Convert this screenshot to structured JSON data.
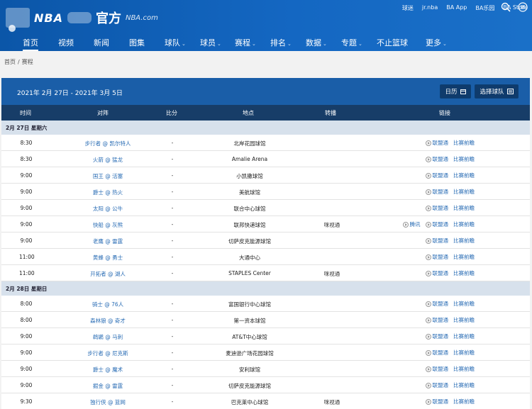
{
  "header": {
    "logo_nba": "NBA",
    "logo_cn": "官方",
    "logo_domain": "NBA.com",
    "top_links": [
      "球迷",
      "jr.nba",
      "BA App",
      "BA乐园",
      "BA Store"
    ]
  },
  "nav": {
    "items": [
      {
        "label": "首页",
        "caret": false,
        "active": true
      },
      {
        "label": "视频",
        "caret": false
      },
      {
        "label": "新闻",
        "caret": false
      },
      {
        "label": "图集",
        "caret": false
      },
      {
        "label": "球队",
        "caret": true
      },
      {
        "label": "球员",
        "caret": true
      },
      {
        "label": "赛程",
        "caret": true
      },
      {
        "label": "排名",
        "caret": true
      },
      {
        "label": "数据",
        "caret": true
      },
      {
        "label": "专题",
        "caret": true
      },
      {
        "label": "不止篮球",
        "caret": false
      },
      {
        "label": "更多",
        "caret": true
      }
    ]
  },
  "breadcrumb": [
    "首页",
    "赛程"
  ],
  "schedule": {
    "date_range": "2021年 2月 27日 - 2021年 3月 5日",
    "calendar_button": "日历",
    "team_button": "选择球队",
    "columns": [
      "时间",
      "对阵",
      "比分",
      "地点",
      "转播",
      "链接"
    ],
    "days": [
      {
        "date": "2月 27日 星期六",
        "games": [
          {
            "time": "8:30",
            "match": "步行者 @ 凯尔特人",
            "score": "-",
            "venue": "北岸花园球馆",
            "broadcast": "",
            "links": [
              "联盟通",
              "比赛前瞻"
            ]
          },
          {
            "time": "8:30",
            "match": "火箭 @ 猛龙",
            "score": "-",
            "venue": "Amalie Arena",
            "broadcast": "",
            "links": [
              "联盟通",
              "比赛前瞻"
            ]
          },
          {
            "time": "9:00",
            "match": "国王 @ 活塞",
            "score": "-",
            "venue": "小凯撒球馆",
            "broadcast": "",
            "links": [
              "联盟通",
              "比赛前瞻"
            ]
          },
          {
            "time": "9:00",
            "match": "爵士 @ 热火",
            "score": "-",
            "venue": "美航球馆",
            "broadcast": "",
            "links": [
              "联盟通",
              "比赛前瞻"
            ]
          },
          {
            "time": "9:00",
            "match": "太阳 @ 公牛",
            "score": "-",
            "venue": "联合中心球馆",
            "broadcast": "",
            "links": [
              "联盟通",
              "比赛前瞻"
            ]
          },
          {
            "time": "9:00",
            "match": "快船 @ 灰熊",
            "score": "-",
            "venue": "联邦快递球馆",
            "broadcast": "咪视通",
            "links": [
              "腾讯",
              "联盟通",
              "比赛前瞻"
            ]
          },
          {
            "time": "9:00",
            "match": "老鹰 @ 雷霆",
            "score": "-",
            "venue": "切萨皮克能源球馆",
            "broadcast": "",
            "links": [
              "联盟通",
              "比赛前瞻"
            ]
          },
          {
            "time": "11:00",
            "match": "黄蜂 @ 勇士",
            "score": "-",
            "venue": "大通中心",
            "broadcast": "",
            "links": [
              "联盟通",
              "比赛前瞻"
            ]
          },
          {
            "time": "11:00",
            "match": "开拓者 @ 湖人",
            "score": "-",
            "venue": "STAPLES Center",
            "broadcast": "咪视通",
            "links": [
              "联盟通",
              "比赛前瞻"
            ]
          }
        ]
      },
      {
        "date": "2月 28日 星期日",
        "games": [
          {
            "time": "8:00",
            "match": "骑士 @ 76人",
            "score": "-",
            "venue": "富国银行中心球馆",
            "broadcast": "",
            "links": [
              "联盟通",
              "比赛前瞻"
            ]
          },
          {
            "time": "8:00",
            "match": "森林狼 @ 奇才",
            "score": "-",
            "venue": "第一资本球馆",
            "broadcast": "",
            "links": [
              "联盟通",
              "比赛前瞻"
            ]
          },
          {
            "time": "9:00",
            "match": "鹈鹕 @ 马刺",
            "score": "-",
            "venue": "AT&T中心球馆",
            "broadcast": "",
            "links": [
              "联盟通",
              "比赛前瞻"
            ]
          },
          {
            "time": "9:00",
            "match": "步行者 @ 尼克斯",
            "score": "-",
            "venue": "麦迪逊广场花园球馆",
            "broadcast": "",
            "links": [
              "联盟通",
              "比赛前瞻"
            ]
          },
          {
            "time": "9:00",
            "match": "爵士 @ 魔术",
            "score": "-",
            "venue": "安利球馆",
            "broadcast": "",
            "links": [
              "联盟通",
              "比赛前瞻"
            ]
          },
          {
            "time": "9:00",
            "match": "掘金 @ 雷霆",
            "score": "-",
            "venue": "切萨皮克能源球馆",
            "broadcast": "",
            "links": [
              "联盟通",
              "比赛前瞻"
            ]
          },
          {
            "time": "9:30",
            "match": "独行侠 @ 篮网",
            "score": "-",
            "venue": "巴克莱中心球馆",
            "broadcast": "咪视通",
            "links": [
              "联盟通",
              "比赛前瞻"
            ]
          }
        ]
      }
    ]
  }
}
